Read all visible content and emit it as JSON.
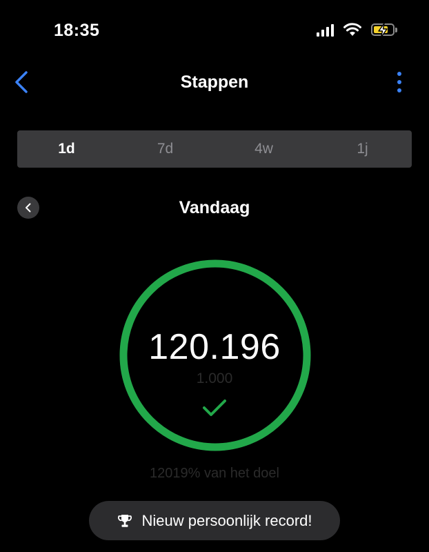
{
  "status_bar": {
    "time": "18:35",
    "signal_icon": "cellular-signal-icon",
    "wifi_icon": "wifi-icon",
    "battery_icon": "battery-charging-icon",
    "battery_level": 0.75
  },
  "nav": {
    "back_icon": "chevron-left-icon",
    "title": "Stappen",
    "more_icon": "vertical-ellipsis-icon"
  },
  "period_tabs": [
    {
      "label": "1d",
      "active": true
    },
    {
      "label": "7d",
      "active": false
    },
    {
      "label": "4w",
      "active": false
    },
    {
      "label": "1j",
      "active": false
    }
  ],
  "day": {
    "prev_icon": "chevron-left-icon",
    "title": "Vandaag"
  },
  "progress": {
    "steps": "120.196",
    "goal": "1.000",
    "goal_fraction": 1.0,
    "percent_text": "12019% van het doel",
    "check_icon": "checkmark-icon"
  },
  "toast": {
    "icon": "trophy-icon",
    "text": "Nieuw persoonlijk record!"
  },
  "colors": {
    "accent": "#3b82f6",
    "ring": "#22a84a",
    "check": "#22a84a",
    "battery_fill": "#f5d22c",
    "background": "#000000"
  }
}
